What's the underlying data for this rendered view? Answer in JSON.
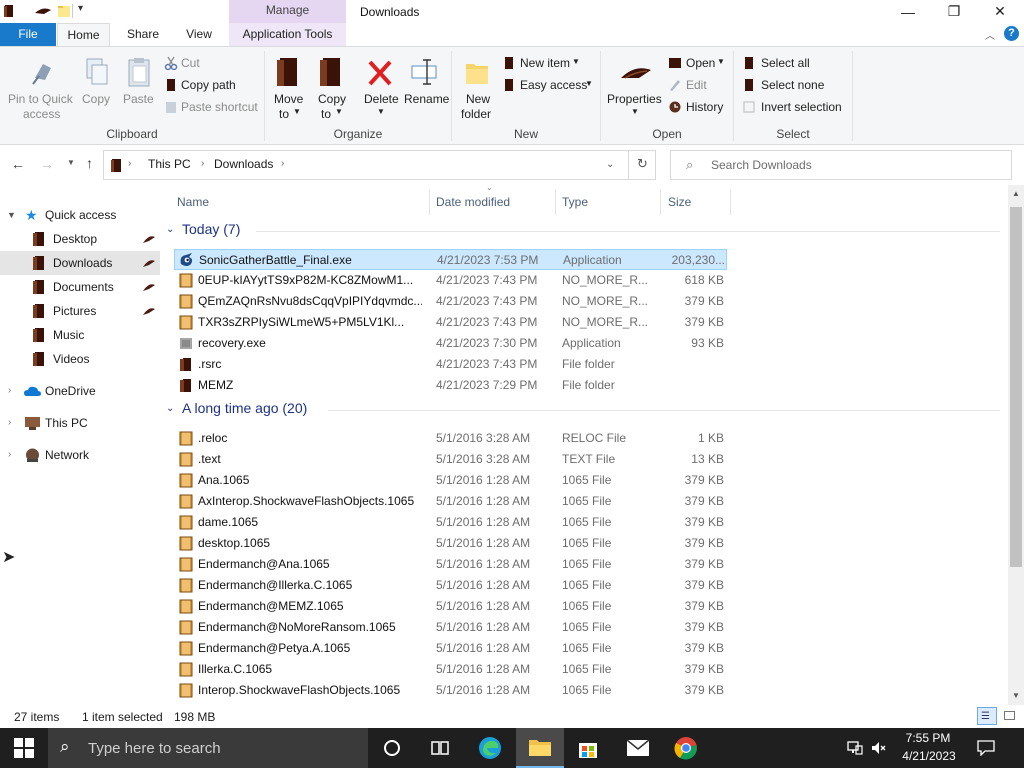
{
  "window": {
    "title": "Downloads",
    "contextual_tab_group": "Manage",
    "controls": [
      "—",
      "❐",
      "✕"
    ]
  },
  "tabs": [
    "File",
    "Home",
    "Share",
    "View",
    "Application Tools"
  ],
  "ribbon": {
    "clipboard": {
      "pin_line1": "Pin to Quick",
      "pin_line2": "access",
      "copy": "Copy",
      "paste": "Paste",
      "cut": "Cut",
      "copy_path": "Copy path",
      "paste_shortcut": "Paste shortcut",
      "group": "Clipboard"
    },
    "organize": {
      "move_to": "Move",
      "move_to2": "to",
      "copy_to": "Copy",
      "copy_to2": "to",
      "delete": "Delete",
      "rename": "Rename",
      "group": "Organize"
    },
    "new": {
      "new_folder": "New",
      "new_folder2": "folder",
      "new_item": "New item",
      "easy_access": "Easy access",
      "group": "New"
    },
    "open": {
      "properties": "Properties",
      "open": "Open",
      "edit": "Edit",
      "history": "History",
      "group": "Open"
    },
    "select": {
      "select_all": "Select all",
      "select_none": "Select none",
      "invert": "Invert selection",
      "group": "Select"
    }
  },
  "address": {
    "crumbs": [
      "This PC",
      "Downloads"
    ],
    "search_placeholder": "Search Downloads"
  },
  "nav": {
    "quick_access": "Quick access",
    "items": [
      {
        "label": "Desktop",
        "pinned": true
      },
      {
        "label": "Downloads",
        "pinned": true
      },
      {
        "label": "Documents",
        "pinned": true
      },
      {
        "label": "Pictures",
        "pinned": true
      },
      {
        "label": "Music",
        "pinned": false
      },
      {
        "label": "Videos",
        "pinned": false
      }
    ],
    "onedrive": "OneDrive",
    "this_pc": "This PC",
    "network": "Network"
  },
  "columns": {
    "name": "Name",
    "date": "Date modified",
    "type": "Type",
    "size": "Size"
  },
  "groups": [
    {
      "title": "Today (7)",
      "files": [
        {
          "name": "SonicGatherBattle_Final.exe",
          "date": "4/21/2023 7:53 PM",
          "type": "Application",
          "size": "203,230...",
          "icon": "exe-sonic",
          "selected": true
        },
        {
          "name": "0EUP-kIAYytTS9xP82M-KC8ZMowM1...",
          "date": "4/21/2023 7:43 PM",
          "type": "NO_MORE_R...",
          "size": "618 KB",
          "icon": "file"
        },
        {
          "name": "QEmZAQnRsNvu8dsCqqVpIPIYdqvmdc...",
          "date": "4/21/2023 7:43 PM",
          "type": "NO_MORE_R...",
          "size": "379 KB",
          "icon": "file"
        },
        {
          "name": "TXR3sZRPIySiWLmeW5+PM5LV1Kl...",
          "date": "4/21/2023 7:43 PM",
          "type": "NO_MORE_R...",
          "size": "379 KB",
          "icon": "file"
        },
        {
          "name": "recovery.exe",
          "date": "4/21/2023 7:30 PM",
          "type": "Application",
          "size": "93 KB",
          "icon": "exe"
        },
        {
          "name": ".rsrc",
          "date": "4/21/2023 7:43 PM",
          "type": "File folder",
          "size": "",
          "icon": "folder"
        },
        {
          "name": "MEMZ",
          "date": "4/21/2023 7:29 PM",
          "type": "File folder",
          "size": "",
          "icon": "folder"
        }
      ]
    },
    {
      "title": "A long time ago (20)",
      "files": [
        {
          "name": ".reloc",
          "date": "5/1/2016 3:28 AM",
          "type": "RELOC File",
          "size": "1 KB",
          "icon": "file"
        },
        {
          "name": ".text",
          "date": "5/1/2016 3:28 AM",
          "type": "TEXT File",
          "size": "13 KB",
          "icon": "file"
        },
        {
          "name": "Ana.1065",
          "date": "5/1/2016 1:28 AM",
          "type": "1065 File",
          "size": "379 KB",
          "icon": "file"
        },
        {
          "name": "AxInterop.ShockwaveFlashObjects.1065",
          "date": "5/1/2016 1:28 AM",
          "type": "1065 File",
          "size": "379 KB",
          "icon": "file"
        },
        {
          "name": "dame.1065",
          "date": "5/1/2016 1:28 AM",
          "type": "1065 File",
          "size": "379 KB",
          "icon": "file"
        },
        {
          "name": "desktop.1065",
          "date": "5/1/2016 1:28 AM",
          "type": "1065 File",
          "size": "379 KB",
          "icon": "file"
        },
        {
          "name": "Endermanch@Ana.1065",
          "date": "5/1/2016 1:28 AM",
          "type": "1065 File",
          "size": "379 KB",
          "icon": "file"
        },
        {
          "name": "Endermanch@Illerka.C.1065",
          "date": "5/1/2016 1:28 AM",
          "type": "1065 File",
          "size": "379 KB",
          "icon": "file"
        },
        {
          "name": "Endermanch@MEMZ.1065",
          "date": "5/1/2016 1:28 AM",
          "type": "1065 File",
          "size": "379 KB",
          "icon": "file"
        },
        {
          "name": "Endermanch@NoMoreRansom.1065",
          "date": "5/1/2016 1:28 AM",
          "type": "1065 File",
          "size": "379 KB",
          "icon": "file"
        },
        {
          "name": "Endermanch@Petya.A.1065",
          "date": "5/1/2016 1:28 AM",
          "type": "1065 File",
          "size": "379 KB",
          "icon": "file"
        },
        {
          "name": "Illerka.C.1065",
          "date": "5/1/2016 1:28 AM",
          "type": "1065 File",
          "size": "379 KB",
          "icon": "file"
        },
        {
          "name": "Interop.ShockwaveFlashObjects.1065",
          "date": "5/1/2016 1:28 AM",
          "type": "1065 File",
          "size": "379 KB",
          "icon": "file"
        }
      ]
    }
  ],
  "status": {
    "items": "27 items",
    "selection": "1 item selected",
    "size": "198 MB"
  },
  "taskbar": {
    "search_placeholder": "Type here to search",
    "time": "7:55 PM",
    "date": "4/21/2023"
  },
  "colors": {
    "file_tab": "#1979ca",
    "manage_tab": "#e5d6f2",
    "selection": "#cce8ff",
    "group_header": "#1e3287",
    "folder_icon": "#4a1c10",
    "taskbar": "#1f1f1f"
  }
}
